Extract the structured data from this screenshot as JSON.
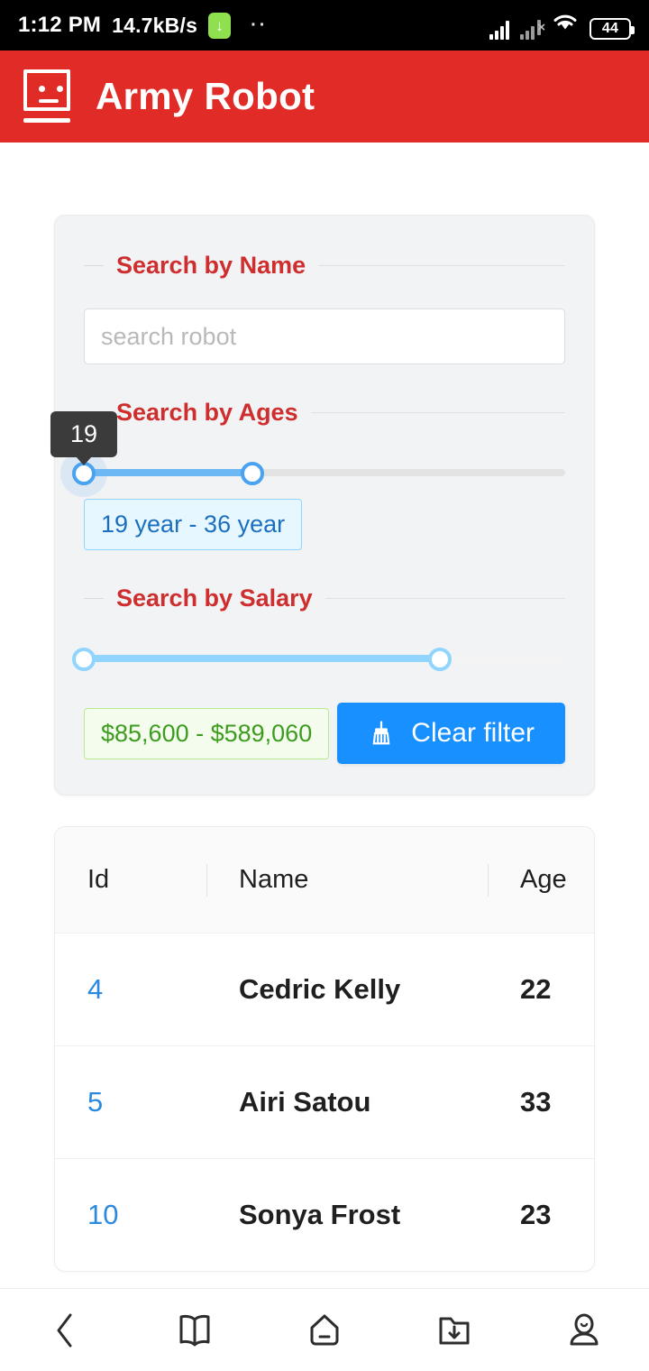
{
  "status_bar": {
    "time": "1:12 PM",
    "network_speed": "14.7kB/s",
    "download_icon": "download-arrow-icon",
    "notification_dots": "··",
    "battery_level": "44",
    "signal_icon": "signal-bars-icon",
    "signal_off_icon": "signal-no-sim-icon",
    "wifi_icon": "wifi-icon"
  },
  "app_bar": {
    "logo_icon": "robot-face-icon",
    "title": "Army Robot",
    "background_color": "#e02b27"
  },
  "filters": {
    "name_section": {
      "legend": "Search by Name",
      "input_placeholder": "search robot",
      "input_value": ""
    },
    "ages_section": {
      "legend": "Search by Ages",
      "tooltip_value": "19",
      "range_label": "19 year - 36 year",
      "min_percent": 0,
      "max_percent": 35
    },
    "salary_section": {
      "legend": "Search by Salary",
      "range_label": "$85,600 - $589,060",
      "min_percent": 0,
      "max_percent": 74
    },
    "clear_button": {
      "label": "Clear filter",
      "icon": "broom-icon",
      "color": "#1890ff"
    },
    "legend_color": "#cf2e2e"
  },
  "table": {
    "columns": [
      "Id",
      "Name",
      "Age"
    ],
    "rows": [
      {
        "id": "4",
        "name": "Cedric Kelly",
        "age": "22"
      },
      {
        "id": "5",
        "name": "Airi Satou",
        "age": "33"
      },
      {
        "id": "10",
        "name": "Sonya Frost",
        "age": "23"
      }
    ]
  },
  "bottom_nav": {
    "items": [
      {
        "icon": "back-chevron-icon",
        "name": "back"
      },
      {
        "icon": "book-icon",
        "name": "library"
      },
      {
        "icon": "home-icon",
        "name": "home"
      },
      {
        "icon": "folder-download-icon",
        "name": "downloads"
      },
      {
        "icon": "profile-icon",
        "name": "profile"
      }
    ]
  }
}
